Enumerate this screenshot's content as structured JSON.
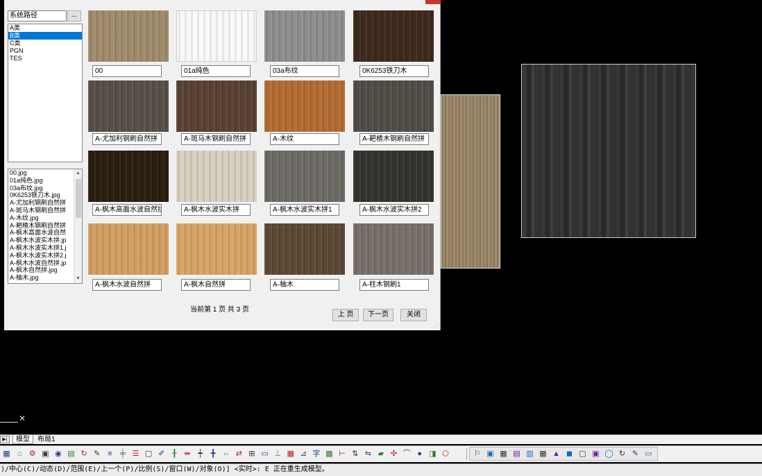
{
  "dialog": {
    "path_field": "系统路径",
    "browse_label": "...",
    "categories": [
      {
        "label": "A类",
        "selected": false
      },
      {
        "label": "B类",
        "selected": true
      },
      {
        "label": "C类",
        "selected": false
      },
      {
        "label": "PGN",
        "selected": false
      },
      {
        "label": "TES",
        "selected": false
      }
    ],
    "files": [
      "00.jpg",
      "01a纯色.jpg",
      "03a布纹.jpg",
      "0K6253铁刀木.jpg",
      "A-尤加利钢刷自然拼",
      "A-斑马木钢刷自然拼",
      "A-木纹.jpg",
      "A-耙楂木钢刷自然拼",
      "A-枫木高面水波自然",
      "A-枫木水波实木拼.jp",
      "A-枫木水波实木拼1.j",
      "A-枫木水波实木拼2.j",
      "A-枫木水波自然拼.jp",
      "A-枫木自然拼.jpg",
      "A-柚木.jpg"
    ],
    "textures": [
      {
        "label": "00",
        "color": "#a08c6c"
      },
      {
        "label": "01a纯色",
        "color": "#f9f9f9"
      },
      {
        "label": "03a布纹",
        "color": "#8e8e8e"
      },
      {
        "label": "0K6253铁刀木",
        "color": "#3d2a1c"
      },
      {
        "label": "A-尤加利钢刷自然拼",
        "color": "#575048"
      },
      {
        "label": "A-斑马木钢刷自然拼",
        "color": "#5a4232"
      },
      {
        "label": "A-木纹",
        "color": "#b46c32"
      },
      {
        "label": "A-耙楂木钢刷自然拼",
        "color": "#514c46"
      },
      {
        "label": "A-枫木高面水波自然拼",
        "color": "#2a1e0f"
      },
      {
        "label": "A-枫木水波实木拼",
        "color": "#d8d0c0"
      },
      {
        "label": "A-枫木水波实木拼1",
        "color": "#6e6b66"
      },
      {
        "label": "A-枫木水波实木拼2",
        "color": "#34332f"
      },
      {
        "label": "A-枫木水波自然拼",
        "color": "#d39f62"
      },
      {
        "label": "A-枫木自然拼",
        "color": "#d8a466"
      },
      {
        "label": "A-柚木",
        "color": "#5c4834"
      },
      {
        "label": "A-柱木钢刷1",
        "color": "#77706a"
      }
    ],
    "page_info": "当前第 1 页 共 3 页",
    "prev_label": "上 页",
    "next_label": "下一页",
    "close_label": "关闭"
  },
  "tabs": [
    {
      "label": "模型",
      "active": true
    },
    {
      "label": "布局1",
      "active": false
    }
  ],
  "toolbar_icons": [
    "new-icon",
    "open-icon",
    "tools-icon",
    "save-icon",
    "render-icon",
    "layer-icon",
    "redo-icon",
    "pen-icon",
    "align-icon",
    "center-icon",
    "list-icon",
    "frame-icon",
    "edit-icon",
    "split-icon",
    "distribute-icon",
    "cursor-icon",
    "grid-icon",
    "mirror-icon",
    "move-icon",
    "array-icon",
    "rect-icon",
    "insert-icon",
    "table-icon",
    "scale-icon",
    "text-icon",
    "hatch-icon",
    "dim-icon",
    "measure-icon",
    "connect-icon",
    "terrain-icon",
    "style-icon",
    "brush-icon",
    "globe-icon",
    "box-icon",
    "shape-icon"
  ],
  "toolbar_glyphs": [
    "▦",
    "⌂",
    "⚙",
    "▣",
    "◉",
    "▤",
    "↻",
    "✎",
    "≡",
    "╪",
    "☰",
    "▢",
    "✐",
    "╂",
    "⇹",
    "┿",
    "╋",
    "⇔",
    "⇄",
    "⊞",
    "▭",
    "⊥",
    "▦",
    "⊿",
    "字",
    "▩",
    "⊢",
    "⇅",
    "⇋",
    "▰",
    "✣",
    "⌒",
    "●",
    "◨",
    "⬡"
  ],
  "toolbar2_icons": [
    "a",
    "b",
    "c",
    "d",
    "e",
    "f",
    "g",
    "h",
    "i",
    "j",
    "k",
    "l",
    "m",
    "n"
  ],
  "toolbar2_glyphs": [
    "⚐",
    "▣",
    "▦",
    "▤",
    "▥",
    "▦",
    "▲",
    "◼",
    "▢",
    "▣",
    "◯",
    "↻",
    "✎",
    "▭"
  ],
  "command_line": ")/中心(C)/动态(D)/范围(E)/上一个(P)/比例(S)/窗口(W)/对象(O)] <实时>: E 正在重生成模型。"
}
